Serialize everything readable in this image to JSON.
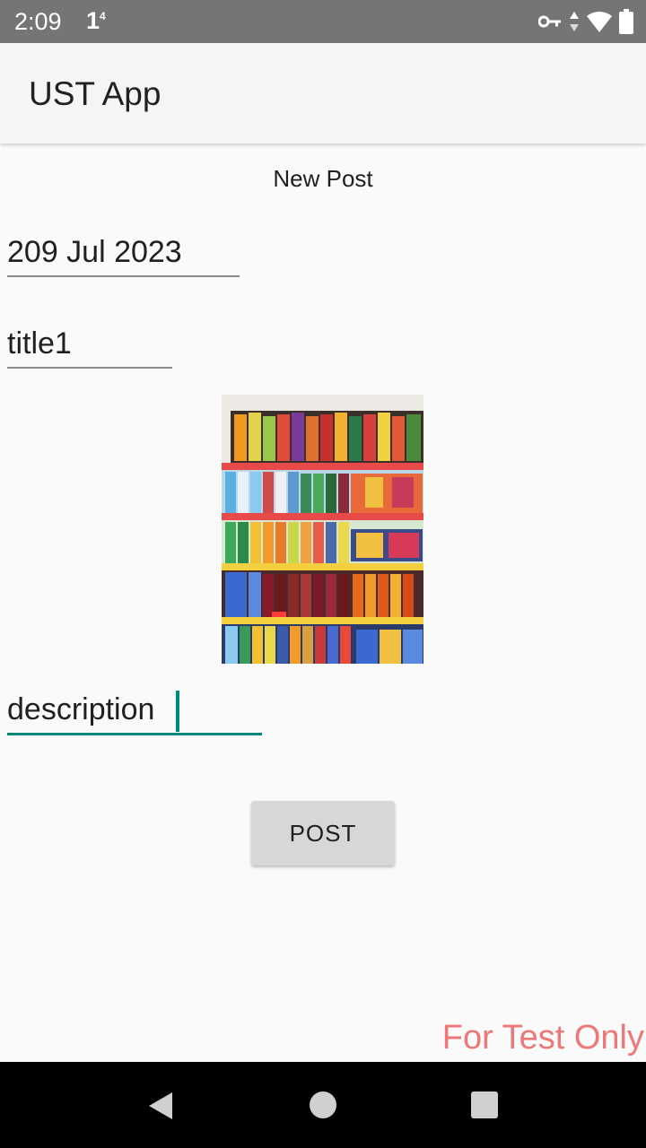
{
  "status_bar": {
    "time": "2:09",
    "signal_label": "1",
    "signal_superscript": "4",
    "icons": [
      "vpn-key-icon",
      "data-arrows-icon",
      "wifi-icon",
      "battery-icon"
    ]
  },
  "app_bar": {
    "title": "UST App"
  },
  "form": {
    "heading": "New Post",
    "date_value": "209 Jul 2023",
    "title_value": "title1",
    "description_value": "description",
    "post_button_label": "POST"
  },
  "watermark": "For Test Only",
  "nav_bar": {
    "icons": [
      "back-icon",
      "home-icon",
      "recents-icon"
    ]
  },
  "colors": {
    "accent": "#00897b",
    "status_bar": "#757575",
    "watermark": "#ee7777"
  }
}
